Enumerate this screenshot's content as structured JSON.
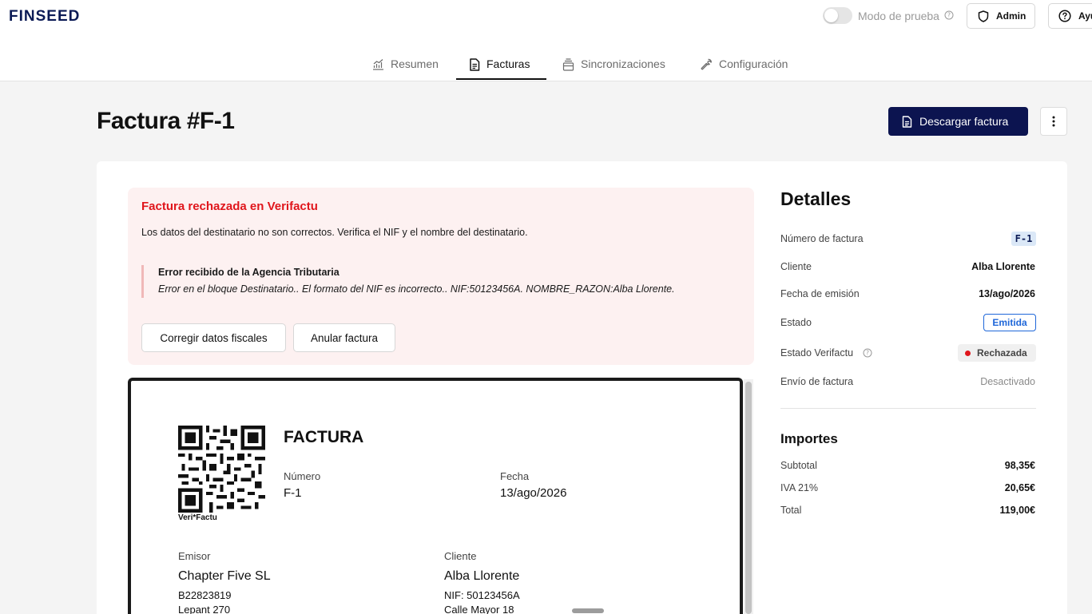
{
  "header": {
    "logo": "FINSEED",
    "test_mode_label": "Modo de prueba",
    "admin_label": "Admin",
    "help_label": "Ayu"
  },
  "tabs": [
    {
      "label": "Resumen",
      "icon": "chart-icon"
    },
    {
      "label": "Facturas",
      "icon": "document-icon"
    },
    {
      "label": "Sincronizaciones",
      "icon": "sync-icon"
    },
    {
      "label": "Configuración",
      "icon": "wrench-icon"
    }
  ],
  "page": {
    "title": "Factura #F-1",
    "download_label": "Descargar factura"
  },
  "alert": {
    "title": "Factura rechazada en Verifactu",
    "message": "Los datos del destinatario no son correctos. Verifica el NIF y el nombre del destinatario.",
    "quote_title": "Error recibido de la Agencia Tributaria",
    "quote_text": "Error en el bloque Destinatario.. El formato del NIF es incorrecto.. NIF:50123456A. NOMBRE_RAZON:Alba Llorente.",
    "fix_label": "Corregir datos fiscales",
    "cancel_label": "Anular factura"
  },
  "invoice": {
    "qr_caption": "Veri*Factu",
    "title": "FACTURA",
    "number_label": "Número",
    "number": "F-1",
    "date_label": "Fecha",
    "date": "13/ago/2026",
    "issuer_label": "Emisor",
    "issuer_name": "Chapter Five SL",
    "issuer_nif": "B22823819",
    "issuer_address": "Lepant 270",
    "client_label": "Cliente",
    "client_name": "Alba Llorente",
    "client_nif": "NIF: 50123456A",
    "client_address": "Calle Mayor 18"
  },
  "details": {
    "title": "Detalles",
    "rows": [
      {
        "label": "Número de factura",
        "value": "F-1"
      },
      {
        "label": "Cliente",
        "value": "Alba Llorente"
      },
      {
        "label": "Fecha de emisión",
        "value": "13/ago/2026"
      },
      {
        "label": "Estado",
        "value": "Emitida"
      },
      {
        "label": "Estado Verifactu",
        "value": "Rechazada"
      },
      {
        "label": "Envío de factura",
        "value": "Desactivado"
      }
    ]
  },
  "amounts": {
    "title": "Importes",
    "rows": [
      {
        "label": "Subtotal",
        "value": "98,35€"
      },
      {
        "label": "IVA 21%",
        "value": "20,65€"
      },
      {
        "label": "Total",
        "value": "119,00€"
      }
    ]
  },
  "colors": {
    "brand": "#0b1a55",
    "primary_button": "#0c1450",
    "error": "#e0161c",
    "alert_bg": "#fdf1f1",
    "status_blue": "#1f67d9"
  }
}
